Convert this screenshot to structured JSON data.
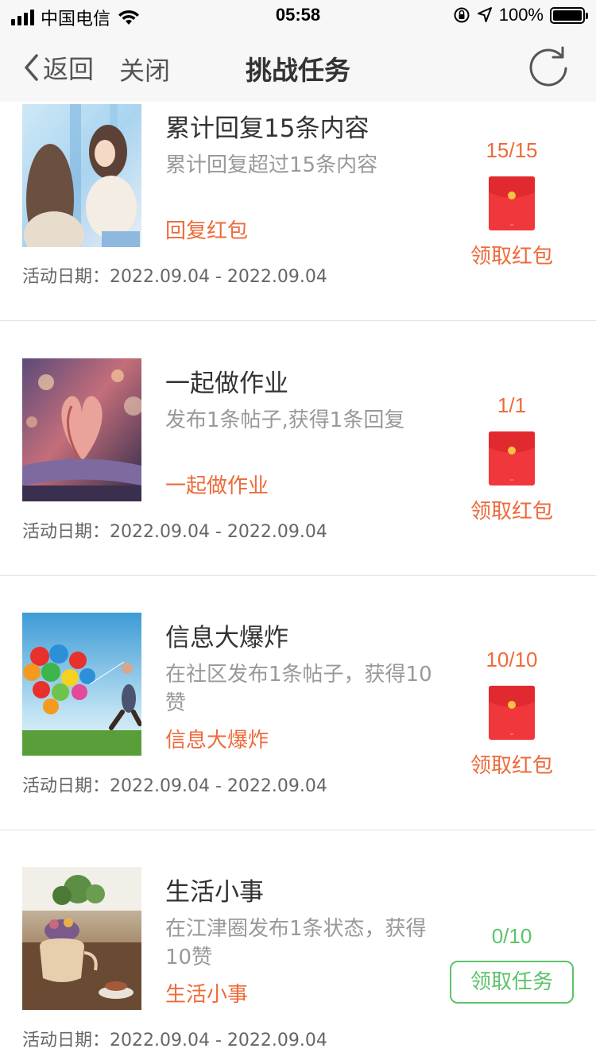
{
  "status_bar": {
    "carrier": "中国电信",
    "time": "05:58",
    "battery_pct": "100%",
    "battery_level": 1.0
  },
  "nav": {
    "back_label": "返回",
    "close_label": "关闭",
    "title": "挑战任务"
  },
  "tasks": [
    {
      "title": "累计回复15条内容",
      "desc": "累计回复超过15条内容",
      "tag": "回复红包",
      "date": "活动日期：2022.09.04 - 2022.09.04",
      "progress": "15/15",
      "action_label": "领取红包",
      "image": "friends-photo"
    },
    {
      "title": "一起做作业",
      "desc": "发布1条帖子,获得1条回复",
      "tag": "一起做作业",
      "date": "活动日期：2022.09.04 - 2022.09.04",
      "progress": "1/1",
      "action_label": "领取红包",
      "image": "heart-book-photo"
    },
    {
      "title": "信息大爆炸",
      "desc": "在社区发布1条帖子，获得10赞",
      "tag": "信息大爆炸",
      "date": "活动日期：2022.09.04 - 2022.09.04",
      "progress": "10/10",
      "action_label": "领取红包",
      "image": "balloons-photo"
    },
    {
      "title": "生活小事",
      "desc": "在江津圈发布1条状态，获得10赞",
      "tag": "生活小事",
      "date": "活动日期：2022.09.04 - 2022.09.04",
      "progress": "0/10",
      "action_label": "领取任务",
      "image": "teapot-photo"
    }
  ],
  "colors": {
    "accent_orange": "#ee6a3a",
    "accent_green": "#5cc36a",
    "envelope_red": "#f0383c",
    "envelope_gold": "#f5c242"
  }
}
